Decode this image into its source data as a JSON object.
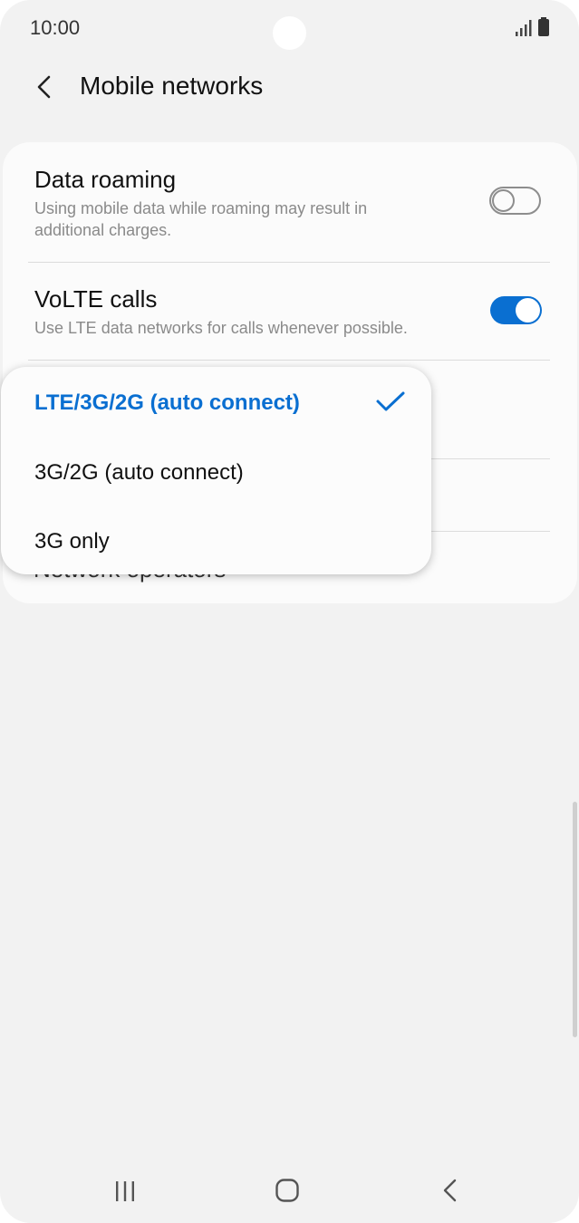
{
  "status_bar": {
    "time": "10:00",
    "signal_icon": "signal-icon",
    "battery_icon": "battery-icon"
  },
  "header": {
    "title": "Mobile networks",
    "back_icon": "back-arrow-icon"
  },
  "settings": {
    "data_roaming": {
      "title": "Data roaming",
      "subtitle": "Using mobile data while roaming may result in additional charges.",
      "enabled": false
    },
    "volte": {
      "title": "VoLTE calls",
      "subtitle": "Use LTE data networks for calls whenever possible.",
      "enabled": true
    },
    "network_operators_label": "Network operators"
  },
  "network_mode_menu": {
    "options": [
      {
        "label": "LTE/3G/2G (auto connect)",
        "selected": true
      },
      {
        "label": "3G/2G (auto connect)",
        "selected": false
      },
      {
        "label": "3G only",
        "selected": false
      }
    ]
  },
  "colors": {
    "accent": "#0a6fd1",
    "background": "#f2f2f2",
    "card": "#fbfbfb"
  },
  "nav_bar": {
    "recents_icon": "recents-icon",
    "home_icon": "home-icon",
    "back_icon": "nav-back-icon"
  }
}
